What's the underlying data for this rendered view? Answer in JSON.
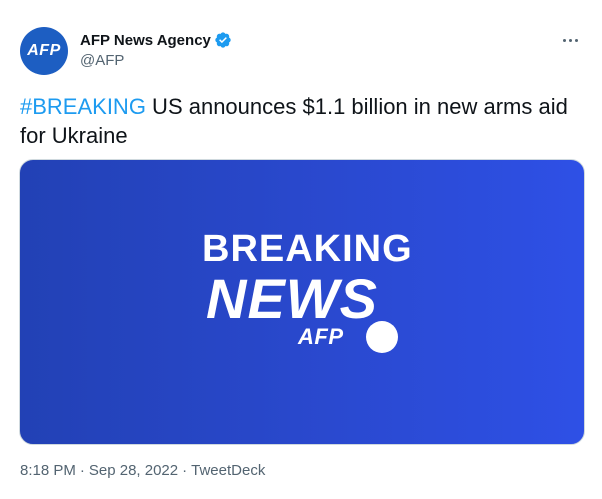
{
  "author": {
    "avatar_text": "AFP",
    "display_name": "AFP News Agency",
    "handle": "@AFP",
    "verified_icon": "verified-badge-icon",
    "avatar_color": "#1d5ec2",
    "verified_color": "#1d9bf0"
  },
  "more_icon": "more-dots-icon",
  "tweet": {
    "hashtag": "#BREAKING",
    "body": " US announces $1.1 billion in new arms aid for Ukraine"
  },
  "media": {
    "line1": "BREAKING",
    "line2": "NEWS",
    "logo_text": "AFP",
    "gradient_start": "#2241b5",
    "gradient_end": "#2e50e6"
  },
  "meta": {
    "time": "8:18 PM",
    "separator": "·",
    "date": "Sep 28, 2022",
    "source": "TweetDeck"
  }
}
